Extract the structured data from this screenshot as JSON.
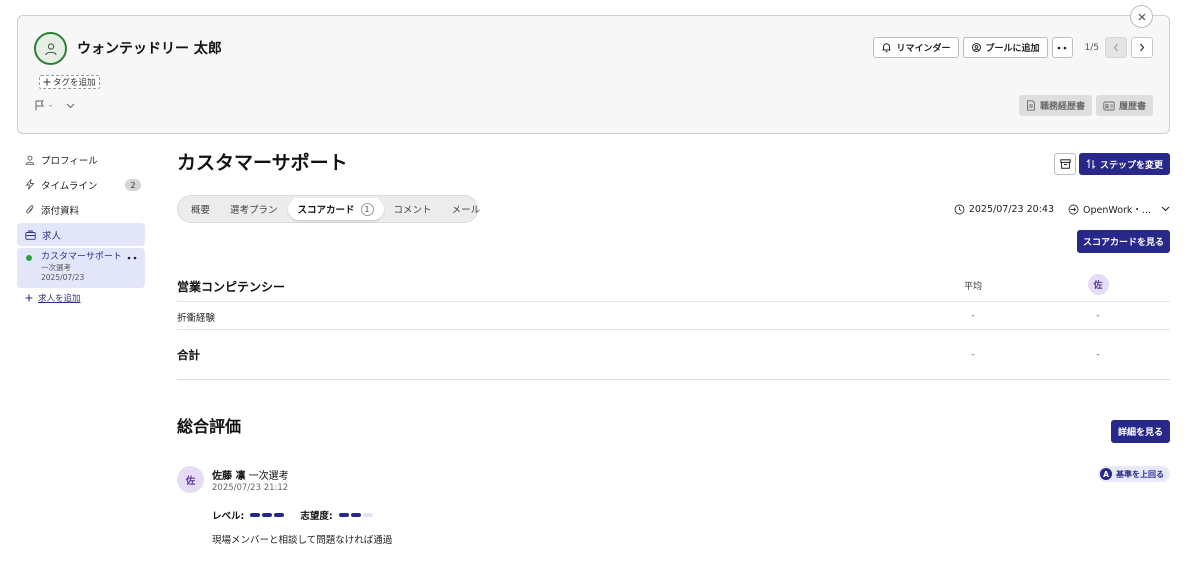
{
  "header": {
    "candidate_name": "ウォンテッドリー 太郎",
    "add_tag": "タグを追加",
    "flag_value": "-",
    "reminder_label": "リマインダー",
    "pool_label": "プールに追加",
    "pager": "1/5",
    "work_history_label": "職務経歴書",
    "resume_label": "履歴書"
  },
  "sidebar": {
    "items": [
      {
        "label": "プロフィール",
        "icon": "person-icon"
      },
      {
        "label": "タイムライン",
        "icon": "bolt-icon",
        "badge": "2"
      },
      {
        "label": "添付資料",
        "icon": "paperclip-icon"
      },
      {
        "label": "求人",
        "icon": "briefcase-icon"
      }
    ],
    "job": {
      "title": "カスタマーサポート",
      "stage": "一次選考",
      "date": "2025/07/23"
    },
    "add_job": "求人を追加"
  },
  "main": {
    "title": "カスタマーサポート",
    "change_step_label": "ステップを変更",
    "tabs": [
      {
        "label": "概要"
      },
      {
        "label": "選考プラン"
      },
      {
        "label": "スコアカード",
        "count": "1",
        "active": true
      },
      {
        "label": "コメント"
      },
      {
        "label": "メール"
      }
    ],
    "meta": {
      "datetime": "2025/07/23 20:43",
      "source": "OpenWork・..."
    },
    "view_scorecard_label": "スコアカードを見る",
    "scorecard": {
      "section": "営業コンピテンシー",
      "avg_header": "平均",
      "reviewer_initial": "佐",
      "rows": [
        {
          "label": "折衝経験",
          "avg": "-",
          "score": "-"
        }
      ],
      "total": {
        "label": "合計",
        "avg": "-",
        "score": "-"
      }
    },
    "overall": {
      "title": "総合評価",
      "detail_label": "詳細を見る",
      "review": {
        "initial": "佐",
        "name": "佐藤 凛",
        "stage": "一次選考",
        "datetime": "2025/07/23 21:12",
        "badge_letter": "A",
        "badge": "基準を上回る",
        "level_label": "レベル:",
        "level": 3,
        "level_max": 3,
        "motivation_label": "志望度:",
        "motivation": 2,
        "motivation_max": 3,
        "comment": "現場メンバーと相談して問題なければ通過"
      }
    }
  },
  "colors": {
    "accent": "#28288a",
    "active_bg": "#e3e6f8",
    "avatar_ring": "#2f7d3a",
    "status_dot": "#27a044"
  }
}
